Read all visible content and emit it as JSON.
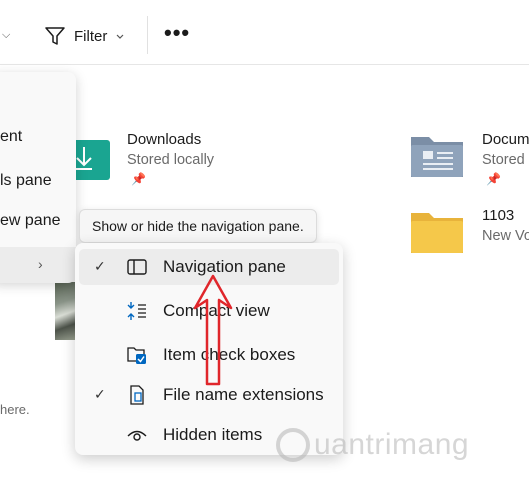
{
  "toolbar": {
    "filter_label": "Filter",
    "more_label": "•••"
  },
  "files": {
    "downloads": {
      "name": "Downloads",
      "sub": "Stored locally"
    },
    "documents": {
      "name": "Docum",
      "sub": "Stored"
    },
    "drive": {
      "name": "1103",
      "sub": "New Vo"
    }
  },
  "left_menu": {
    "items": [
      "ent",
      "ls pane",
      "ew pane"
    ]
  },
  "here_text": "here.",
  "tooltip": "Show or hide the navigation pane.",
  "submenu": {
    "items": [
      {
        "label": "Navigation pane",
        "checked": true,
        "icon": "navigation-pane-icon"
      },
      {
        "label": "Compact view",
        "checked": false,
        "icon": "compact-view-icon"
      },
      {
        "label": "Item check boxes",
        "checked": false,
        "icon": "item-check-boxes-icon"
      },
      {
        "label": "File name extensions",
        "checked": true,
        "icon": "file-extension-icon"
      },
      {
        "label": "Hidden items",
        "checked": false,
        "icon": "hidden-items-icon"
      }
    ],
    "check_glyph": "✓"
  },
  "watermark": "uantrimang",
  "colors": {
    "accent": "#0067c0",
    "arrow": "#e0262b",
    "folder": "#f5c84a",
    "downloads_icon": "#1aa591"
  }
}
